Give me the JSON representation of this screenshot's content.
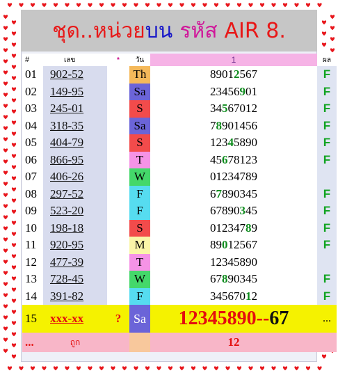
{
  "title": {
    "part1": "ชุด..",
    "part2": "หน่วย",
    "part3": "บน",
    "part4": "รหัส",
    "part5": "AIR 8."
  },
  "header": {
    "idx": "#",
    "num": "เลข",
    "star": "*",
    "day": "วัน",
    "pattern": "1",
    "result": "ผล"
  },
  "rows": [
    {
      "idx": "01",
      "num": "902-52",
      "day": "Th",
      "pattern": [
        "8901",
        "2",
        "567"
      ],
      "result": "F",
      "day_color": "#f5b95a"
    },
    {
      "idx": "02",
      "num": "149-95",
      "day": "Sa",
      "pattern": [
        "23456",
        "9",
        "01"
      ],
      "result": "F",
      "day_color": "#6b64d8"
    },
    {
      "idx": "03",
      "num": "245-01",
      "day": "S",
      "pattern": [
        "34",
        "5",
        "67012"
      ],
      "result": "F",
      "day_color": "#f24b4b"
    },
    {
      "idx": "04",
      "num": "318-35",
      "day": "Sa",
      "pattern": [
        "7",
        "8",
        "901456"
      ],
      "result": "F",
      "day_color": "#6b64d8"
    },
    {
      "idx": "05",
      "num": "404-79",
      "day": "S",
      "pattern": [
        "123",
        "4",
        "5890"
      ],
      "result": "F",
      "day_color": "#f24b4b"
    },
    {
      "idx": "06",
      "num": "866-95",
      "day": "T",
      "pattern": [
        "45",
        "6",
        "78123"
      ],
      "result": "F",
      "day_color": "#f593e6"
    },
    {
      "idx": "07",
      "num": "406-26",
      "day": "W",
      "pattern": [
        "01234789",
        "",
        ""
      ],
      "result": "",
      "day_color": "#44d86a"
    },
    {
      "idx": "08",
      "num": "297-52",
      "day": "F",
      "pattern": [
        "6",
        "7",
        "890345"
      ],
      "result": "F",
      "day_color": "#56dcf0"
    },
    {
      "idx": "09",
      "num": "523-20",
      "day": "F",
      "pattern": [
        "67890",
        "3",
        "45"
      ],
      "result": "F",
      "day_color": "#56dcf0"
    },
    {
      "idx": "10",
      "num": "198-18",
      "day": "S",
      "pattern": [
        "012347",
        "8",
        "9"
      ],
      "result": "F",
      "day_color": "#f24b4b"
    },
    {
      "idx": "11",
      "num": "920-95",
      "day": "M",
      "pattern": [
        "89",
        "0",
        "12567"
      ],
      "result": "F",
      "day_color": "#faf5a8"
    },
    {
      "idx": "12",
      "num": "477-39",
      "day": "T",
      "pattern": [
        "12345890",
        "",
        ""
      ],
      "result": "",
      "day_color": "#f593e6"
    },
    {
      "idx": "13",
      "num": "728-45",
      "day": "W",
      "pattern": [
        "67",
        "8",
        "90345"
      ],
      "result": "F",
      "day_color": "#44d86a"
    },
    {
      "idx": "14",
      "num": "391-82",
      "day": "F",
      "pattern": [
        "345670",
        "1",
        "2"
      ],
      "result": "F",
      "day_color": "#56dcf0"
    }
  ],
  "prediction": {
    "idx": "15",
    "num": "xxx-xx",
    "star": "?",
    "day": "Sa",
    "pattern_main": "12345890--",
    "pattern_tail": "67",
    "result": "..."
  },
  "footer": {
    "idx": "...",
    "label": "ถูก",
    "count": "12"
  },
  "colors": {
    "heart": "#e8161c",
    "highlight_digit": "#0f8c1e"
  }
}
